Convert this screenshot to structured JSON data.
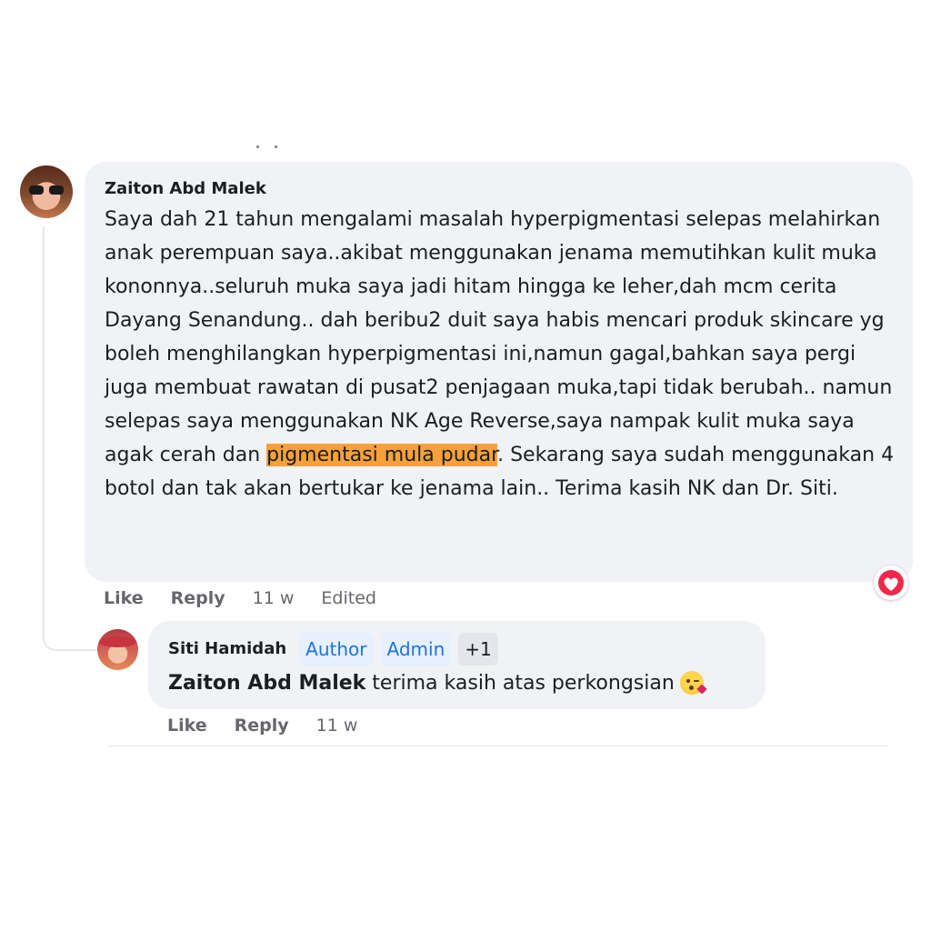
{
  "comment": {
    "author": "Zaiton Abd Malek",
    "text_before": "Saya dah 21 tahun mengalami masalah hyperpigmentasi selepas melahirkan anak perempuan saya..akibat menggunakan jenama memutihkan kulit muka kononnya..seluruh muka saya jadi hitam hingga ke leher,dah mcm cerita Dayang Senandung.. dah beribu2 duit saya habis mencari produk skincare yg boleh menghilangkan hyperpigmentasi ini,namun gagal,bahkan saya pergi juga membuat rawatan di pusat2 penjagaan muka,tapi tidak berubah.. namun selepas saya menggunakan NK Age Reverse,saya nampak kulit muka saya agak cerah dan ",
    "text_highlight": "pigmentasi mula pudar",
    "text_after": ". Sekarang saya sudah menggunakan 4 botol dan tak akan bertukar ke jenama lain.. Terima kasih NK dan Dr. Siti.",
    "reaction_icon": "heart-reaction-icon",
    "actions": {
      "like": "Like",
      "reply": "Reply",
      "time": "11 w",
      "edited": "Edited"
    }
  },
  "reply": {
    "author": "Siti Hamidah",
    "badges": [
      "Author",
      "Admin",
      "+1"
    ],
    "mention": "Zaiton Abd Malek",
    "text": " terima kasih atas perkongsian",
    "emoji": "face-blowing-kiss-emoji",
    "actions": {
      "like": "Like",
      "reply": "Reply",
      "time": "11 w"
    }
  },
  "colors": {
    "bubble": "#f0f2f5",
    "highlight": "#f7a13a",
    "badge_text": "#1b74e4",
    "badge_bg": "#e7f0fd",
    "heart": "#f02849",
    "secondary_text": "#65676b"
  }
}
